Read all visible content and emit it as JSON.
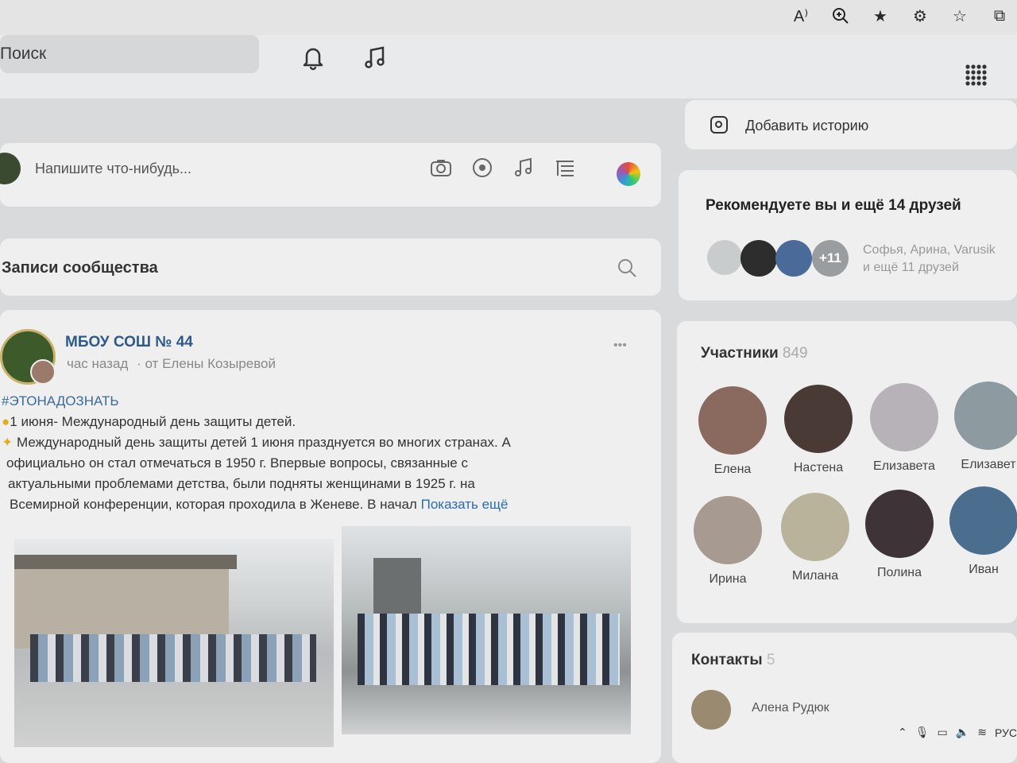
{
  "browser": {
    "icons": [
      "read-aloud-icon",
      "zoom-icon",
      "favorite-star-icon",
      "extensions-icon",
      "favorites-icon",
      "collections-icon"
    ]
  },
  "header": {
    "search_placeholder": "Поиск",
    "icons": [
      "bell-icon",
      "music-icon",
      "apps-grid-icon"
    ]
  },
  "composer": {
    "placeholder": "Напишите что-нибудь...",
    "icons": [
      "camera-icon",
      "video-icon",
      "music-note-icon",
      "article-icon",
      "color-circle-icon"
    ]
  },
  "community_posts": {
    "title": "Записи сообщества"
  },
  "post": {
    "author": "МБОУ СОШ № 44",
    "time": "час назад",
    "from": "· от Елены Козыревой",
    "hashtag": "#ЭТОНАДОЗНАТЬ",
    "line1": "1 июня- Международный день защиты детей.",
    "line2": "Международный день защиты детей 1 июня празднуется во многих странах. А",
    "line3": "официально он стал отмечаться в 1950 г. Впервые вопросы, связанные с",
    "line4": "актуальными проблемами детства, были подняты женщинами в 1925 г. на",
    "line5": "Всемирной конференции, которая проходила в Женеве. В начал",
    "show_more": "Показать ещё",
    "menu": "•••"
  },
  "stories": {
    "add_label": "Добавить историю"
  },
  "recommend": {
    "title": "Рекомендуете вы и ещё 14 друзей",
    "badge": "+11",
    "names_line1": "Софья, Арина, Varusik",
    "names_line2": "и ещё 11 друзей"
  },
  "members": {
    "title": "Участники",
    "count": "849",
    "people": [
      {
        "name": "Елена",
        "color": "#8a6a5e"
      },
      {
        "name": "Настена",
        "color": "#4a3a35"
      },
      {
        "name": "Елизавета",
        "color": "#b7b2b8"
      },
      {
        "name": "Елизавет",
        "color": "#8d9aa0"
      },
      {
        "name": "Ирина",
        "color": "#a79a90"
      },
      {
        "name": "Милана",
        "color": "#b8b39a"
      },
      {
        "name": "Полина",
        "color": "#3e3438"
      },
      {
        "name": "Иван",
        "color": "#4c6e8e"
      }
    ]
  },
  "contacts": {
    "title": "Контакты",
    "count": "5",
    "first": "Алена Рудюк"
  },
  "taskbar": {
    "lang": "РУС"
  }
}
